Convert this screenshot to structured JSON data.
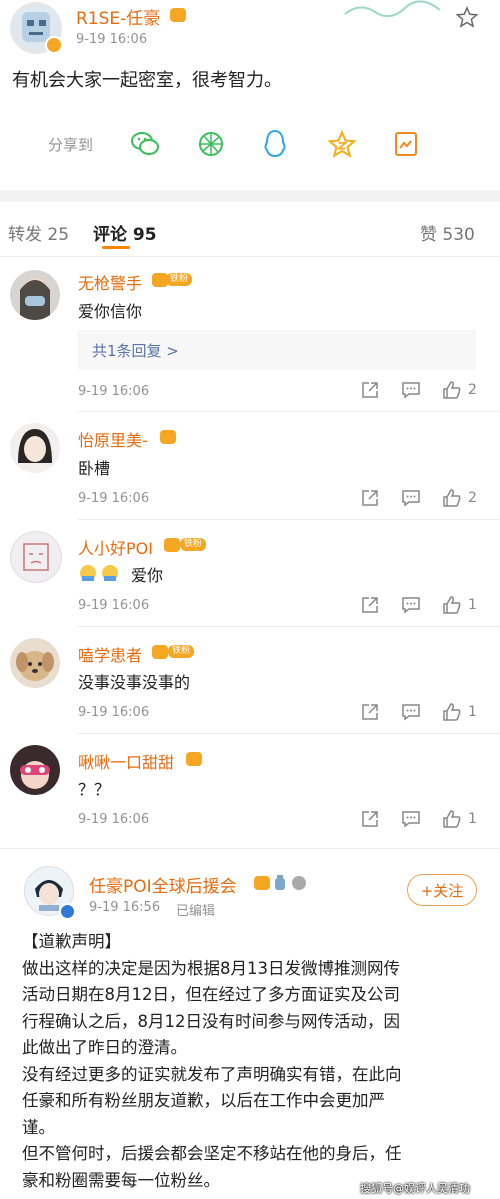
{
  "post": {
    "author": "R1SE-任豪",
    "time": "9-19 16:06",
    "text": "有机会大家一起密室，很考智力。",
    "share_label": "分享到"
  },
  "tabs": {
    "repost": "转发 25",
    "comments": "评论 95",
    "likes": "赞 530"
  },
  "comments": [
    {
      "name": "无枪警手",
      "badge": "铁粉",
      "text": "爱你信你",
      "reply": "共1条回复 >",
      "time": "9-19 16:06",
      "likes": "2"
    },
    {
      "name": "怡原里美-",
      "badge": "",
      "text": "卧槽",
      "time": "9-19 16:06",
      "likes": "2"
    },
    {
      "name": "人小好POI",
      "badge": "铁粉",
      "text": "爱你",
      "time": "9-19 16:06",
      "likes": "1"
    },
    {
      "name": "嗑学患者",
      "badge": "铁粉",
      "text": "没事没事没事的",
      "time": "9-19 16:06",
      "likes": "1"
    },
    {
      "name": "啾啾一口甜甜",
      "badge": "",
      "text": "？？",
      "time": "9-19 16:06",
      "likes": "1"
    }
  ],
  "repost": {
    "author": "任豪POI全球后援会",
    "time": "9-19 16:56",
    "edited": "已编辑",
    "follow": "+关注",
    "lines": [
      "【道歉声明】",
      "做出这样的决定是因为根据8月13日发微博推测网传",
      "活动日期在8月12日，但在经过了多方面证实及公司",
      "行程确认之后，8月12日没有时间参与网传活动，因",
      "此做出了昨日的澄清。",
      "没有经过更多的证实就发布了声明确实有错，在此向",
      "任豪和所有粉丝朋友道歉，以后在工作中会更加严",
      "谨。",
      "但不管何时，后援会都会坚定不移站在他的身后，任",
      "豪和粉圈需要每一位粉丝。"
    ]
  },
  "watermark": "搜狐号@娱评人吴清功"
}
